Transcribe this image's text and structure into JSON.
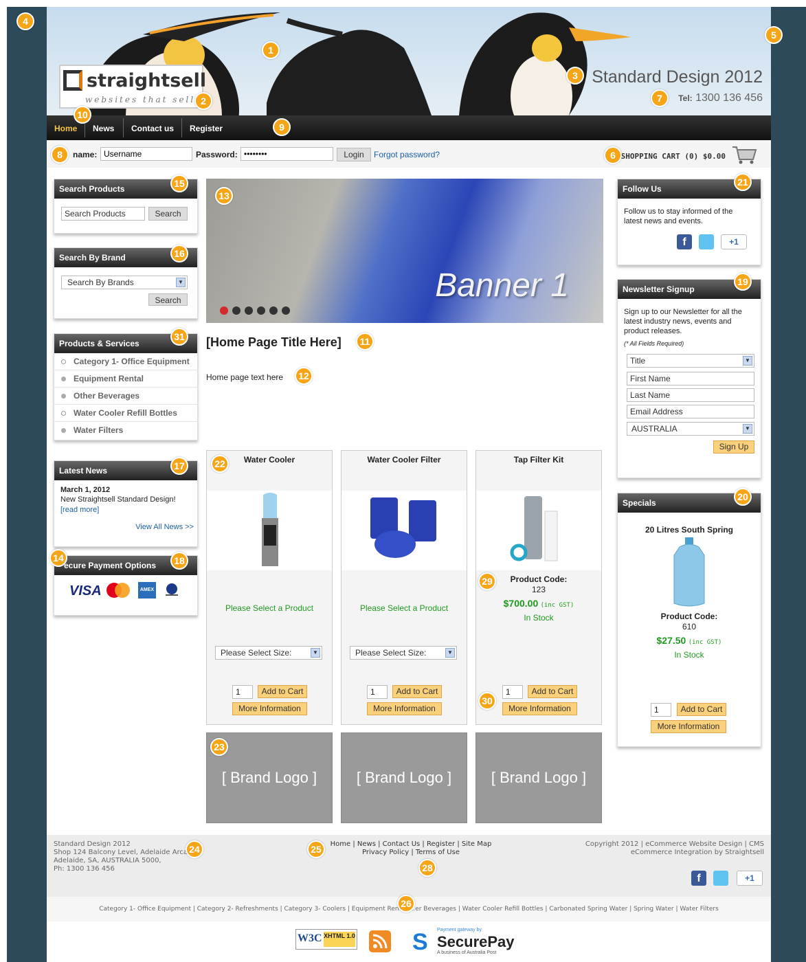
{
  "header": {
    "site_title": "Standard Design 2012",
    "tel_label": "Tel:",
    "tel_number": "1300 136 456",
    "logo_name": "straightsell",
    "logo_tagline": "websites that sell"
  },
  "nav": [
    "Home",
    "News",
    "Contact us",
    "Register"
  ],
  "login": {
    "username_label": "name:",
    "username_value": "Username",
    "password_label": "Password:",
    "password_value": "••••••••",
    "login_button": "Login",
    "forgot_link": "Forgot password?"
  },
  "cart": {
    "label": "SHOPPING CART (0) $0.00"
  },
  "search_products": {
    "title": "Search Products",
    "input_value": "Search Products",
    "button": "Search"
  },
  "search_brand": {
    "title": "Search By Brand",
    "select_value": "Search By Brands",
    "button": "Search"
  },
  "products_services": {
    "title": "Products & Services",
    "items": [
      "Category 1- Office Equipment",
      "Equipment Rental",
      "Other Beverages",
      "Water Cooler Refill Bottles",
      "Water Filters"
    ]
  },
  "latest_news": {
    "title": "Latest News",
    "date": "March 1, 2012",
    "headline": "New Straightsell Standard Design!",
    "read_more": "[read more]",
    "view_all": "View All News >>"
  },
  "secure_payment": {
    "title": "ecure Payment Options",
    "cards": [
      "VISA",
      "MasterCard",
      "AMEX",
      "Diners Club"
    ]
  },
  "banner": {
    "text": "Banner 1",
    "dots": 6
  },
  "home": {
    "title": "[Home Page Title Here]",
    "text": "Home page text here"
  },
  "products": [
    {
      "name": "Water Cooler",
      "select_prompt": "Please Select a Product",
      "size": "Please Select Size:",
      "qty": "1",
      "add": "Add to Cart",
      "more": "More Information"
    },
    {
      "name": "Water Cooler Filter",
      "select_prompt": "Please Select a Product",
      "size": "Please Select Size:",
      "qty": "1",
      "add": "Add to Cart",
      "more": "More Information"
    },
    {
      "name": "Tap Filter Kit",
      "code_label": "Product Code:",
      "code": "123",
      "price": "$700.00",
      "gst": "(inc GST)",
      "stock": "In Stock",
      "qty": "1",
      "add": "Add to Cart",
      "more": "More Information"
    }
  ],
  "brand_logo": "[ Brand Logo ]",
  "follow_us": {
    "title": "Follow Us",
    "text": "Follow us to stay informed of the latest news and events.",
    "plus": "+1"
  },
  "newsletter": {
    "title": "Newsletter Signup",
    "text": "Sign up to our Newsletter for all the latest industry news, events and product releases.",
    "required": "(* All Fields Required)",
    "title_select": "Title",
    "first": "First Name",
    "last": "Last Name",
    "email": "Email Address",
    "country": "AUSTRALIA",
    "button": "Sign Up"
  },
  "specials": {
    "title": "Specials",
    "product": "20 Litres South Spring",
    "code_label": "Product Code:",
    "code": "610",
    "price": "$27.50",
    "gst": "(inc GST)",
    "stock": "In Stock",
    "qty": "1",
    "add": "Add to Cart",
    "more": "More Information"
  },
  "footer": {
    "address": [
      "Standard Design 2012",
      "Shop 124 Balcony Level, Adelaide Arcade,",
      "Adelaide, SA, AUSTRALIA 5000,",
      "Ph: 1300 136 456"
    ],
    "links1": "Home | News | Contact Us | Register | Site Map",
    "links2": "Privacy Policy | Terms of Use",
    "copyright1": "Copyright 2012 | eCommerce Website Design | CMS",
    "copyright2": "eCommerce Integration by Straightsell",
    "categories": "Category 1- Office Equipment | Category 2- Refreshments | Category 3- Coolers | Equipment Rent... ...er Beverages | Water Cooler Refill Bottles | Carbonated Spring Water | Spring Water | Water Filters",
    "xhtml": "XHTML 1.0",
    "securepay_top": "Payment gateway by",
    "securepay": "SecurePay",
    "securepay_sub": "A business of Australia Post"
  },
  "badges": [
    "1",
    "2",
    "3",
    "4",
    "5",
    "6",
    "7",
    "8",
    "9",
    "10",
    "11",
    "12",
    "13",
    "14",
    "15",
    "16",
    "17",
    "18",
    "19",
    "20",
    "21",
    "22",
    "23",
    "24",
    "25",
    "26",
    "28",
    "29",
    "30",
    "31"
  ],
  "colors": {
    "badge": "#f5a516",
    "frame": "#2c4a59",
    "price_green": "#1f9a1f",
    "button_orange": "#fbd07a"
  }
}
